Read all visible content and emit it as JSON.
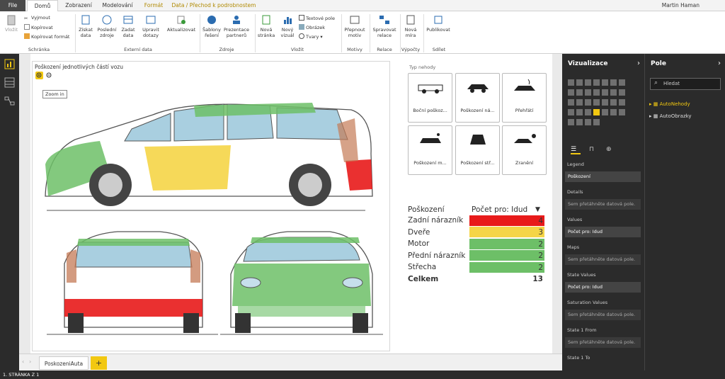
{
  "tabs": {
    "file": "File",
    "items": [
      "Domů",
      "Zobrazení",
      "Modelování",
      "Formát",
      "Data / Přechod k podrobnostem"
    ],
    "active": "Domů"
  },
  "user": "Martin Haman",
  "ribbon": {
    "paste": "Vložit",
    "cut": "Vyjmout",
    "copy": "Kopírovat",
    "copy_format": "Kopírovat formát",
    "get_data": "Získat data",
    "recent_sources": "Poslední zdroje",
    "enter_data": "Zadat data",
    "edit_queries": "Upravit dotazy",
    "refresh": "Aktualizovat",
    "templates": "Šablony řešení",
    "partner_showcase": "Prezentace partnerů",
    "new_page": "Nová stránka",
    "new_visual": "Nový vizuál",
    "textbox": "Textové pole",
    "image": "Obrázek",
    "shapes": "Tvary",
    "switch_theme": "Přepnout motiv",
    "manage_relations": "Spravovat relace",
    "new_measure": "Nová míra",
    "publish": "Publikovat",
    "groups": {
      "clipboard": "Schránka",
      "external": "Externí data",
      "sources": "Zdroje",
      "insert": "Vložit",
      "themes": "Motivy",
      "relations": "Relace",
      "calcs": "Výpočty",
      "share": "Sdílet"
    }
  },
  "visual": {
    "title": "Poškození jednotlivých částí vozu",
    "tooltip": "Zoom in"
  },
  "slicer": {
    "title": "Typ nehody",
    "tiles": [
      "Boční poškoz...",
      "Poškození ná...",
      "Přehřátí",
      "Poškození m...",
      "Poškození stř...",
      "Zranění"
    ]
  },
  "table": {
    "col1": "Poškození",
    "col2": "Počet pro: Idud",
    "rows": [
      {
        "name": "Zadní nárazník",
        "value": "4",
        "color": "#e81a1a"
      },
      {
        "name": "Dveře",
        "value": "3",
        "color": "#f5d547"
      },
      {
        "name": "Motor",
        "value": "2",
        "color": "#6dbf67"
      },
      {
        "name": "Přední nárazník",
        "value": "2",
        "color": "#6dbf67"
      },
      {
        "name": "Střecha",
        "value": "2",
        "color": "#6dbf67"
      }
    ],
    "total_label": "Celkem",
    "total_value": "13"
  },
  "pagetab": "PoskozeniAuta",
  "addpage": "+",
  "status": "1. STRÁNKA Z 1",
  "vizpane": {
    "title": "Vizualizace",
    "wells": [
      {
        "label": "Legend",
        "value": "Poškození",
        "filled": true
      },
      {
        "label": "Details",
        "value": "Sem přetáhněte datová pole.",
        "filled": false
      },
      {
        "label": "Values",
        "value": "Počet pro: Idud",
        "filled": true
      },
      {
        "label": "Maps",
        "value": "Sem přetáhněte datová pole.",
        "filled": false
      },
      {
        "label": "State Values",
        "value": "Počet pro: Idud",
        "filled": true
      },
      {
        "label": "Saturation Values",
        "value": "Sem přetáhněte datová pole.",
        "filled": false
      },
      {
        "label": "State 1 From",
        "value": "Sem přetáhněte datová pole.",
        "filled": false
      },
      {
        "label": "State 1 To",
        "value": "",
        "filled": false
      }
    ]
  },
  "fieldpane": {
    "title": "Pole",
    "search_placeholder": "Hledat",
    "fields": [
      "AutoNehody",
      "AutoObrazky"
    ]
  }
}
